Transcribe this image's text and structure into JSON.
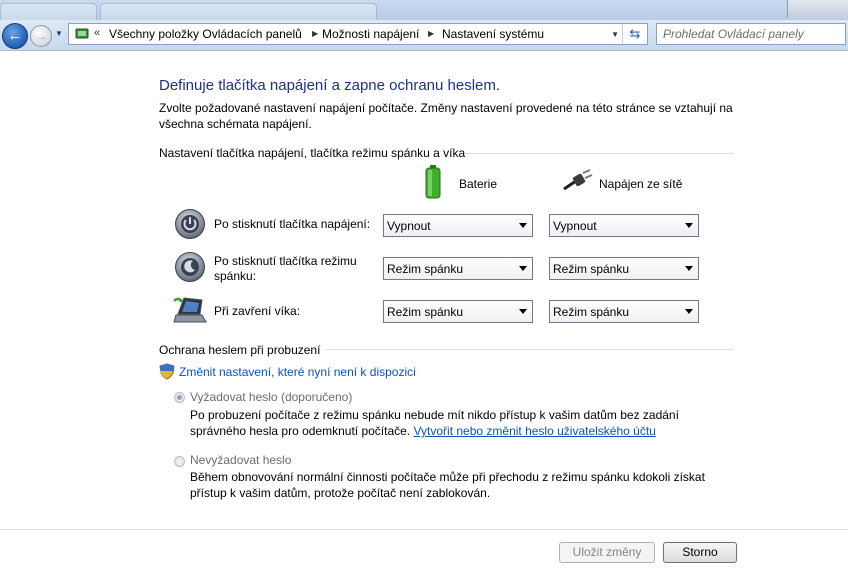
{
  "window": {
    "nav_back_glyph": "←",
    "nav_forward_glyph": "→",
    "breadcrumb_overflow": "«",
    "breadcrumbs": [
      "Všechny položky Ovládacích panelů",
      "Možnosti napájení",
      "Nastavení systému"
    ],
    "search_placeholder": "Prohledat Ovládací panely"
  },
  "page": {
    "title": "Definuje tlačítka napájení a zapne ochranu heslem.",
    "intro": "Zvolte požadované nastavení napájení počítače. Změny nastavení provedené na této stránce se vztahují na všechna schémata napájení."
  },
  "buttons_section": {
    "heading": "Nastavení tlačítka napájení, tlačítka režimu spánku a víka",
    "columns": {
      "battery": "Baterie",
      "plugged_in": "Napájen ze sítě"
    },
    "rows": [
      {
        "label": "Po stisknutí tlačítka napájení:",
        "battery": "Vypnout",
        "plugged_in": "Vypnout",
        "icon": "power-button-icon"
      },
      {
        "label": "Po stisknutí tlačítka režimu spánku:",
        "battery": "Režim spánku",
        "plugged_in": "Režim spánku",
        "icon": "sleep-button-icon"
      },
      {
        "label": "Při zavření víka:",
        "battery": "Režim spánku",
        "plugged_in": "Režim spánku",
        "icon": "laptop-lid-icon"
      }
    ]
  },
  "password_section": {
    "heading": "Ochrana heslem při probuzení",
    "change_link": "Změnit nastavení, které nyní není k dispozici",
    "require": {
      "label": "Vyžadovat heslo (doporučeno)",
      "checked": true,
      "desc_before": "Po probuzení počítače z režimu spánku nebude mít nikdo přístup k vašim datům bez zadání správného hesla pro odemknutí počítače. ",
      "desc_link": "Vytvořit nebo změnit heslo uživatelského účtu"
    },
    "dont_require": {
      "label": "Nevyžadovat heslo",
      "checked": false,
      "desc": "Během obnovování normální činnosti počítače může při přechodu z režimu spánku kdokoli získat přístup k vašim datům, protože počítač není zablokován."
    }
  },
  "footer": {
    "save_label": "Uložit změny",
    "cancel_label": "Storno"
  }
}
